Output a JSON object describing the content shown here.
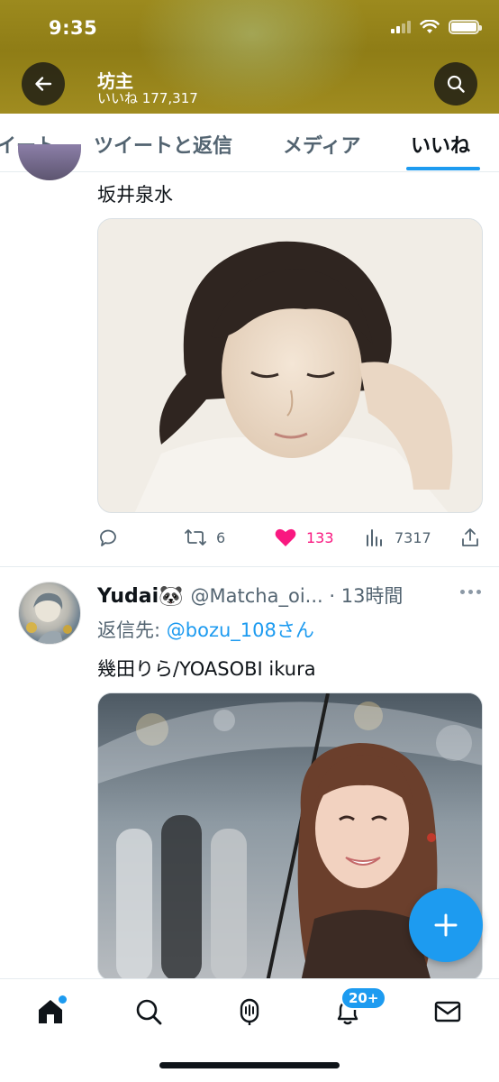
{
  "status_bar": {
    "time": "9:35"
  },
  "header": {
    "name": "坊主",
    "likes_label": "いいね 177,317",
    "back_icon": "arrow-left-icon",
    "search_icon": "search-icon"
  },
  "tabs": [
    {
      "label": "イート"
    },
    {
      "label": "ツイートと返信"
    },
    {
      "label": "メディア"
    },
    {
      "label": "いいね",
      "active": true
    }
  ],
  "tweet1": {
    "text": "坂井泉水",
    "actions": {
      "reply": "",
      "retweet": "6",
      "like": "133",
      "views": "7317"
    }
  },
  "tweet2": {
    "display_name": "Yudai🐼",
    "handle_time": "@Matcha_oi... · 13時間",
    "reply_prefix": "返信先: ",
    "reply_mention": "@bozu_108さん",
    "text": "幾田りら/YOASOBI ikura"
  },
  "bottom_nav": {
    "notification_badge": "20+"
  },
  "colors": {
    "accent": "#1d9bf0",
    "like": "#f91880",
    "header_bg": "#9c8a1e"
  }
}
